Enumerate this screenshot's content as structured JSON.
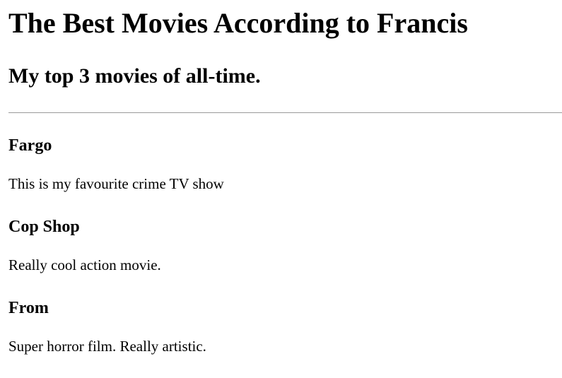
{
  "header": {
    "title": "The Best Movies According to Francis",
    "subtitle": "My top 3 movies of all-time."
  },
  "movies": [
    {
      "title": "Fargo",
      "description": "This is my favourite crime TV show"
    },
    {
      "title": "Cop Shop",
      "description": "Really cool action movie."
    },
    {
      "title": "From",
      "description": "Super horror film. Really artistic."
    }
  ]
}
